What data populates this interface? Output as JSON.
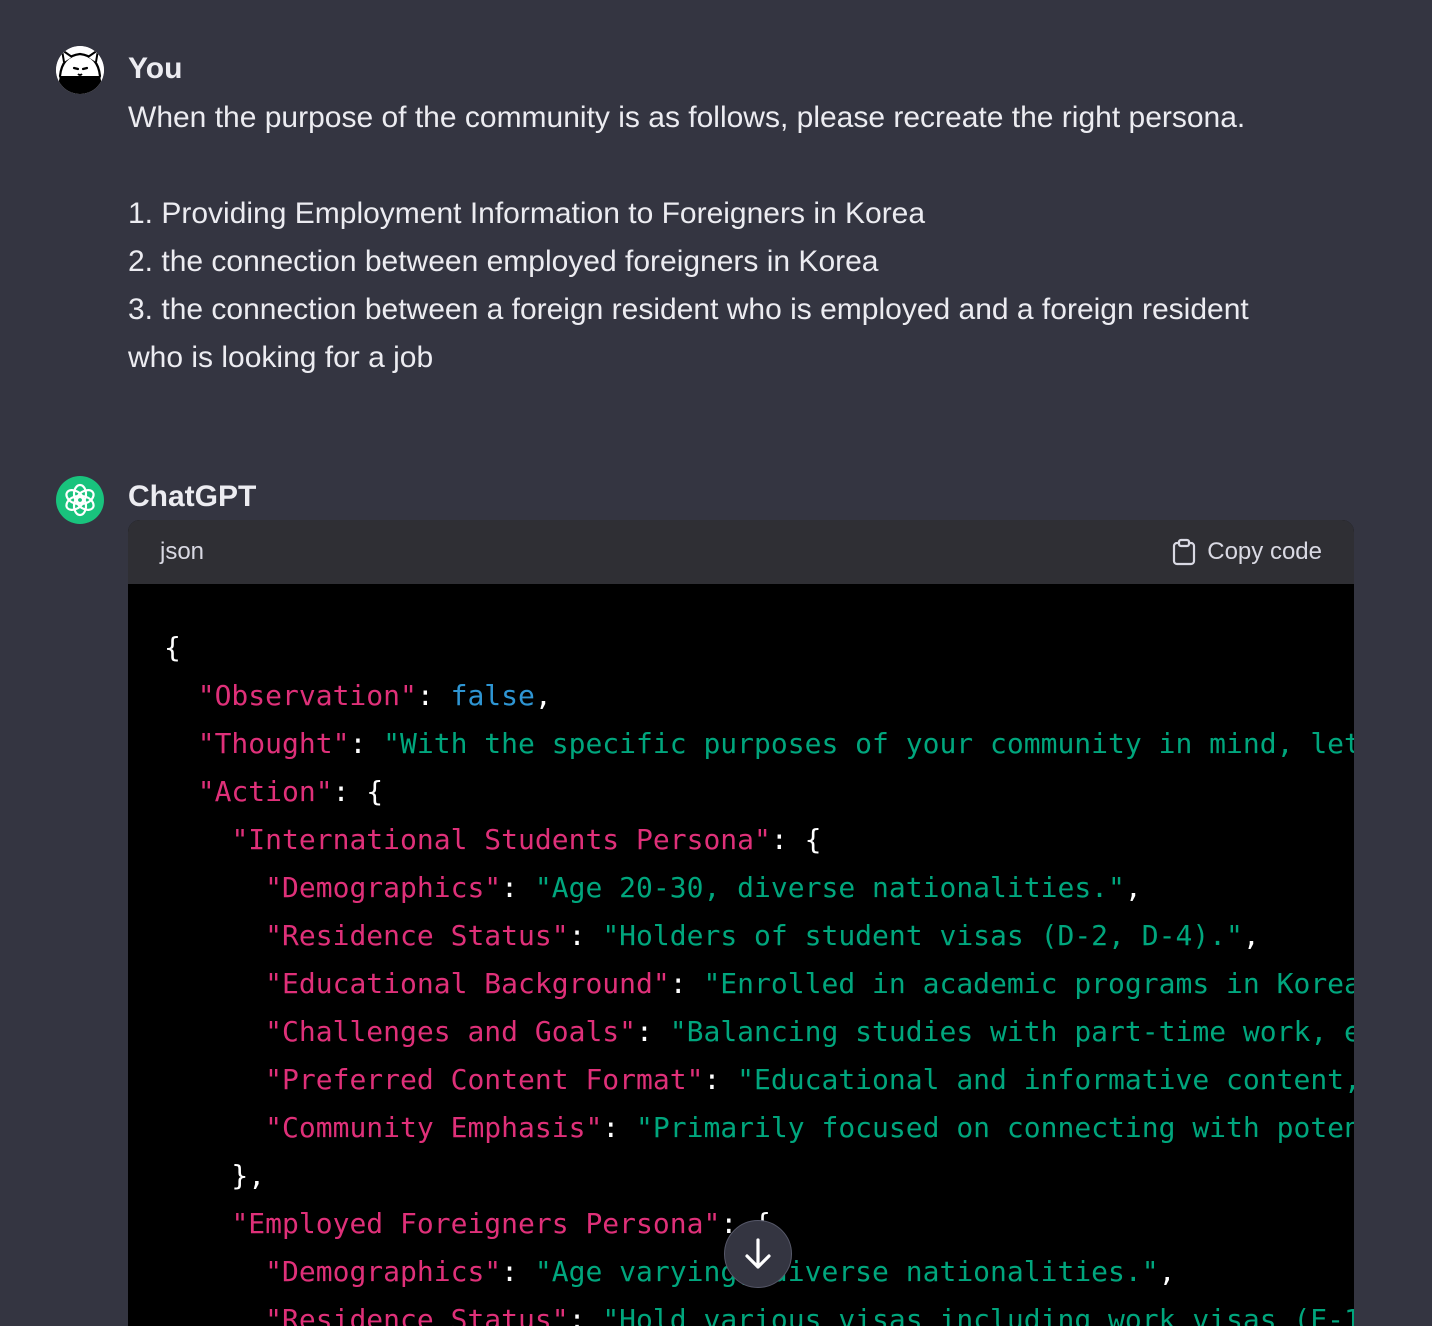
{
  "conversation": {
    "user": {
      "author": "You",
      "lines": [
        "When the purpose of the community is as follows, please recreate the right persona.",
        "",
        "1. Providing Employment Information to Foreigners in Korea",
        "2. the connection between employed foreigners in Korea",
        "3. the connection between a foreign resident who is employed and a foreign resident",
        "who is looking for a job"
      ]
    },
    "assistant": {
      "author": "ChatGPT",
      "code_block": {
        "language": "json",
        "copy_label": "Copy code",
        "lines": [
          [
            {
              "t": "p",
              "v": "{"
            }
          ],
          [
            {
              "t": "p",
              "v": "  "
            },
            {
              "t": "k",
              "v": "\"Observation\""
            },
            {
              "t": "p",
              "v": ": "
            },
            {
              "t": "b",
              "v": "false"
            },
            {
              "t": "p",
              "v": ","
            }
          ],
          [
            {
              "t": "p",
              "v": "  "
            },
            {
              "t": "k",
              "v": "\"Thought\""
            },
            {
              "t": "p",
              "v": ": "
            },
            {
              "t": "s",
              "v": "\"With the specific purposes of your community in mind, let"
            }
          ],
          [
            {
              "t": "p",
              "v": "  "
            },
            {
              "t": "k",
              "v": "\"Action\""
            },
            {
              "t": "p",
              "v": ": {"
            }
          ],
          [
            {
              "t": "p",
              "v": "    "
            },
            {
              "t": "k",
              "v": "\"International Students Persona\""
            },
            {
              "t": "p",
              "v": ": {"
            }
          ],
          [
            {
              "t": "p",
              "v": "      "
            },
            {
              "t": "k",
              "v": "\"Demographics\""
            },
            {
              "t": "p",
              "v": ": "
            },
            {
              "t": "s",
              "v": "\"Age 20-30, diverse nationalities.\""
            },
            {
              "t": "p",
              "v": ","
            }
          ],
          [
            {
              "t": "p",
              "v": "      "
            },
            {
              "t": "k",
              "v": "\"Residence Status\""
            },
            {
              "t": "p",
              "v": ": "
            },
            {
              "t": "s",
              "v": "\"Holders of student visas (D-2, D-4).\""
            },
            {
              "t": "p",
              "v": ","
            }
          ],
          [
            {
              "t": "p",
              "v": "      "
            },
            {
              "t": "k",
              "v": "\"Educational Background\""
            },
            {
              "t": "p",
              "v": ": "
            },
            {
              "t": "s",
              "v": "\"Enrolled in academic programs in Korea"
            }
          ],
          [
            {
              "t": "p",
              "v": "      "
            },
            {
              "t": "k",
              "v": "\"Challenges and Goals\""
            },
            {
              "t": "p",
              "v": ": "
            },
            {
              "t": "s",
              "v": "\"Balancing studies with part-time work, e"
            }
          ],
          [
            {
              "t": "p",
              "v": "      "
            },
            {
              "t": "k",
              "v": "\"Preferred Content Format\""
            },
            {
              "t": "p",
              "v": ": "
            },
            {
              "t": "s",
              "v": "\"Educational and informative content,"
            }
          ],
          [
            {
              "t": "p",
              "v": "      "
            },
            {
              "t": "k",
              "v": "\"Community Emphasis\""
            },
            {
              "t": "p",
              "v": ": "
            },
            {
              "t": "s",
              "v": "\"Primarily focused on connecting with poten"
            }
          ],
          [
            {
              "t": "p",
              "v": "    },"
            }
          ],
          [
            {
              "t": "p",
              "v": "    "
            },
            {
              "t": "k",
              "v": "\"Employed Foreigners Persona\""
            },
            {
              "t": "p",
              "v": ": {"
            }
          ],
          [
            {
              "t": "p",
              "v": "      "
            },
            {
              "t": "k",
              "v": "\"Demographics\""
            },
            {
              "t": "p",
              "v": ": "
            },
            {
              "t": "s",
              "v": "\"Age varying, diverse nationalities.\""
            },
            {
              "t": "p",
              "v": ","
            }
          ],
          [
            {
              "t": "p",
              "v": "      "
            },
            {
              "t": "k",
              "v": "\"Residence Status\""
            },
            {
              "t": "p",
              "v": ": "
            },
            {
              "t": "s",
              "v": "\"Hold various visas including work visas (E-1"
            }
          ]
        ]
      }
    }
  },
  "colors": {
    "background": "#343541",
    "code_background": "#000000",
    "key": "#df3079",
    "string": "#00a67d",
    "boolean": "#2e95d3",
    "gpt_avatar": "#19c37d"
  },
  "icons": {
    "user_avatar": "cat-face-icon",
    "assistant_avatar": "openai-logo-icon",
    "copy": "clipboard-icon",
    "scroll_down": "arrow-down-icon"
  }
}
